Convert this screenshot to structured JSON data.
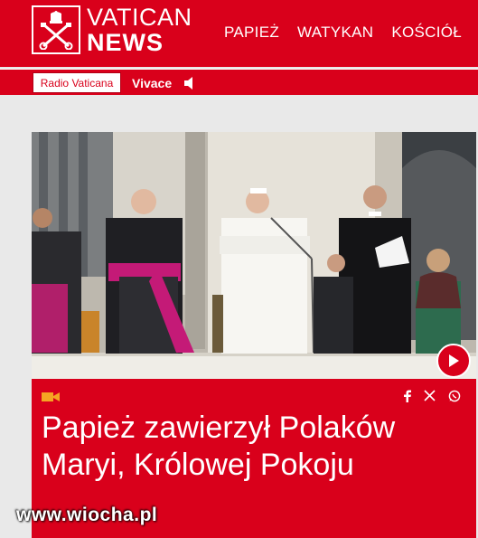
{
  "header": {
    "logo_top": "VATICAN",
    "logo_bottom": "NEWS",
    "nav": [
      "PAPIEŻ",
      "WATYKAN",
      "KOŚCIÓŁ"
    ]
  },
  "radio": {
    "station_label": "Radio Vaticana",
    "channel": "Vivace"
  },
  "article": {
    "media_type_icon": "video-camera-icon",
    "share_icons": [
      "facebook-icon",
      "x-icon",
      "whatsapp-icon"
    ],
    "headline": "Papież zawierzył Polaków Maryi, Królowej Pokoju"
  },
  "watermark": "www.wiocha.pl",
  "colors": {
    "brand_red": "#d9001b",
    "white": "#ffffff",
    "page_bg": "#e9e9e9"
  }
}
